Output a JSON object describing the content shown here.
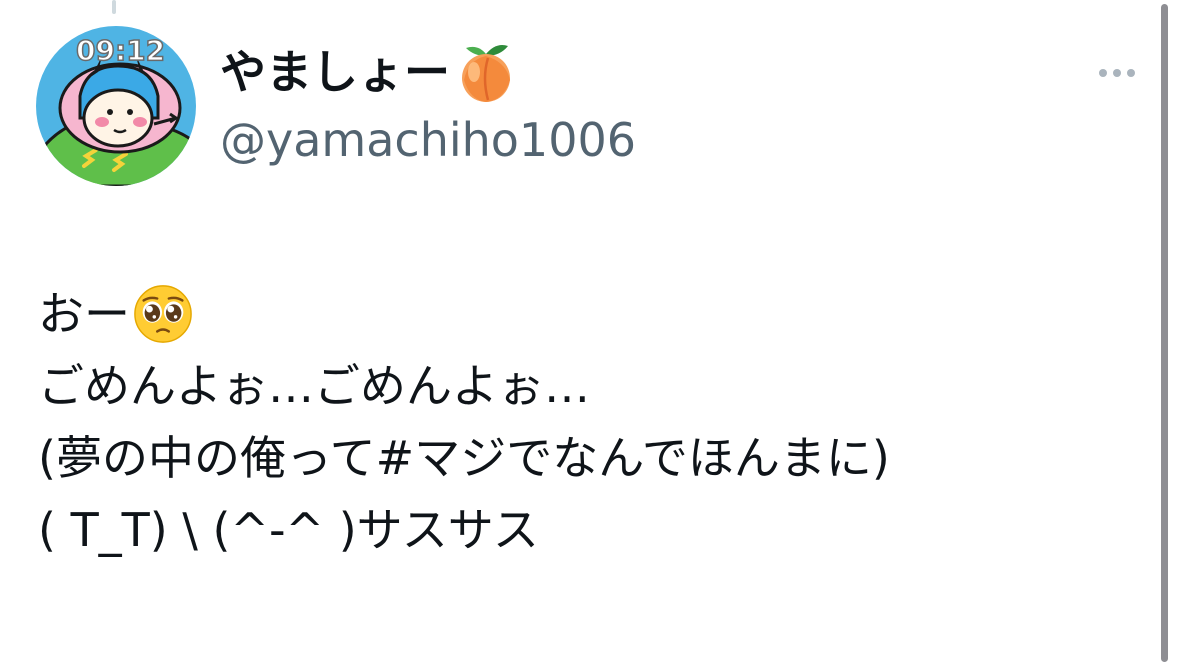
{
  "user": {
    "display_name": "やましょー",
    "name_emoji": "peach-emoji",
    "handle": "@yamachiho1006",
    "avatar_clock": "09:12"
  },
  "tweet": {
    "line1_text": "おー",
    "line1_emoji": "pleading-face-emoji",
    "line2": "ごめんよぉ…ごめんよぉ…",
    "line3": "(夢の中の俺って#マジでなんでほんまに)",
    "line4": "( T_T) \\ (^-^ )サスサス"
  },
  "menu": {
    "icon": "more-dots-icon"
  },
  "colors": {
    "text": "#0f1419",
    "secondary": "#536471",
    "avatar_bg": "#4fb4e4",
    "scrollbar": "#8e8e93"
  }
}
